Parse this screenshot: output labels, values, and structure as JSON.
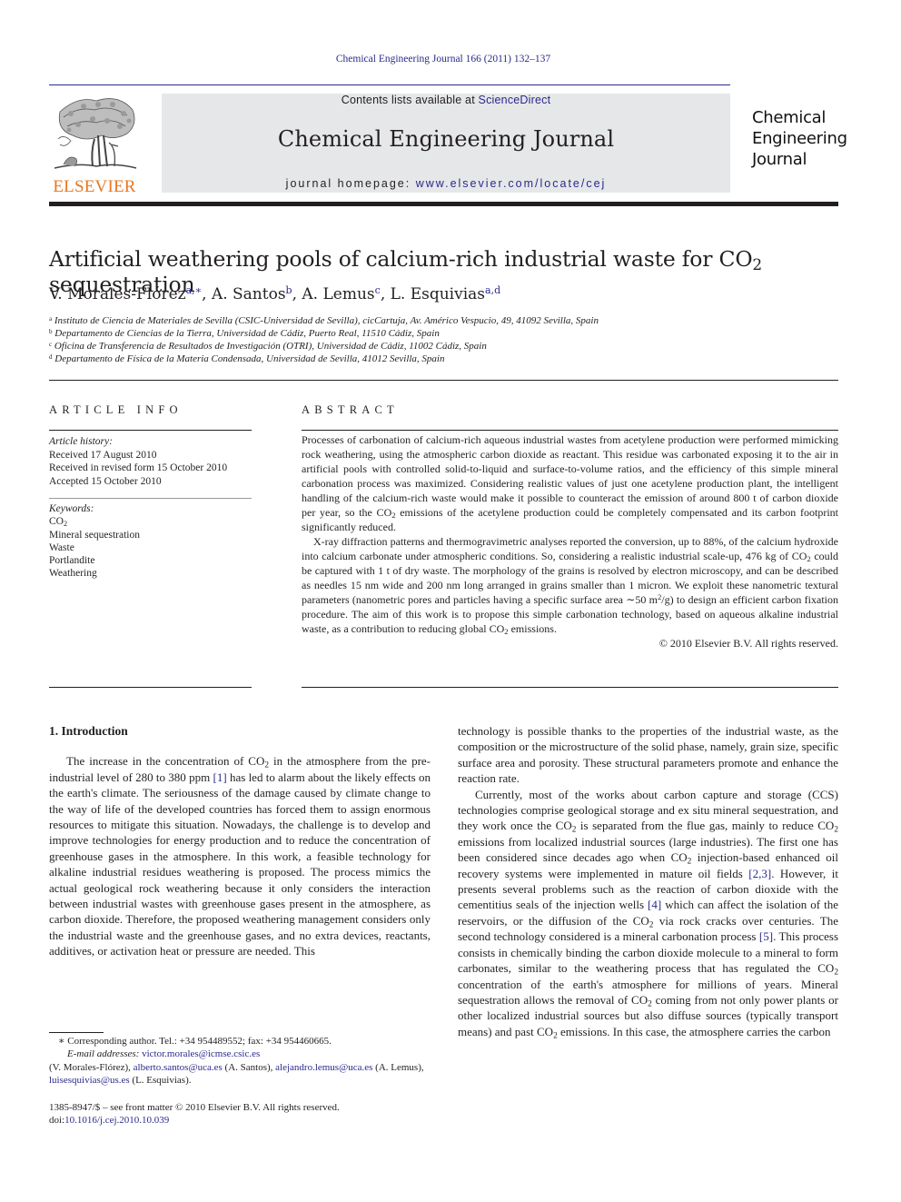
{
  "header": {
    "citation": "Chemical Engineering Journal 166 (2011) 132–137",
    "contents_prefix": "Contents lists available at ",
    "contents_link": "ScienceDirect",
    "journal_name": "Chemical Engineering Journal",
    "homepage_prefix": "journal homepage: ",
    "homepage_link": "www.elsevier.com/locate/cej",
    "publisher_logo_text": "ELSEVIER",
    "cover_title_lines": [
      "Chemical",
      "Engineering",
      "Journal"
    ],
    "colors": {
      "link": "#2a2a8c",
      "elsevier_orange": "#e87722",
      "banner_bg": "#e6e7e8"
    }
  },
  "article": {
    "title_main": "Artificial weathering pools of calcium-rich industrial waste for CO",
    "title_sub": "2",
    "title_end": " sequestration",
    "authors": [
      {
        "name": "V. Morales-Flórez",
        "affil": "a,∗"
      },
      {
        "name": "A. Santos",
        "affil": "b"
      },
      {
        "name": "A. Lemus",
        "affil": "c"
      },
      {
        "name": "L. Esquivias",
        "affil": "a,d"
      }
    ],
    "affiliations": [
      {
        "mark": "a",
        "text": "Instituto de Ciencia de Materiales de Sevilla (CSIC-Universidad de Sevilla), cicCartuja, Av. Américo Vespucio, 49, 41092 Sevilla, Spain"
      },
      {
        "mark": "b",
        "text": "Departamento de Ciencias de la Tierra, Universidad de Cádiz, Puerto Real, 11510 Cádiz, Spain"
      },
      {
        "mark": "c",
        "text": "Oficina de Transferencia de Resultados de Investigación (OTRI), Universidad de Cádiz, 11002 Cádiz, Spain"
      },
      {
        "mark": "d",
        "text": "Departamento de Física de la Materia Condensada, Universidad de Sevilla, 41012 Sevilla, Spain"
      }
    ]
  },
  "article_info": {
    "heading": "ARTICLE INFO",
    "history_label": "Article history:",
    "history": [
      "Received 17 August 2010",
      "Received in revised form 15 October 2010",
      "Accepted 15 October 2010"
    ],
    "keywords_label": "Keywords:",
    "keyword_co2_main": "CO",
    "keyword_co2_sub": "2",
    "keywords": [
      "Mineral sequestration",
      "Waste",
      "Portlandite",
      "Weathering"
    ]
  },
  "abstract": {
    "heading": "ABSTRACT",
    "p1a": "Processes of carbonation of calcium-rich aqueous industrial wastes from acetylene production were performed mimicking rock weathering, using the atmospheric carbon dioxide as reactant. This residue was carbonated exposing it to the air in artificial pools with controlled solid-to-liquid and surface-to-volume ratios, and the efficiency of this simple mineral carbonation process was maximized. Considering realistic values of just one acetylene production plant, the intelligent handling of the calcium-rich waste would make it possible to counteract the emission of around 800 t of carbon dioxide per year, so the CO",
    "p1b": " emissions of the acetylene production could be completely compensated and its carbon footprint significantly reduced.",
    "p2a": "X-ray diffraction patterns and thermogravimetric analyses reported the conversion, up to 88%, of the calcium hydroxide into calcium carbonate under atmospheric conditions. So, considering a realistic industrial scale-up, 476 kg of CO",
    "p2b": " could be captured with 1 t of dry waste. The morphology of the grains is resolved by electron microscopy, and can be described as needles 15 nm wide and 200 nm long arranged in grains smaller than 1 micron. We exploit these nanometric textural parameters (nanometric pores and particles having a specific surface area ∼50 m",
    "p2c": "/g) to design an efficient carbon fixation procedure. The aim of this work is to propose this simple carbonation technology, based on aqueous alkaline industrial waste, as a contribution to reducing global CO",
    "p2d": " emissions.",
    "sub2": "2",
    "sup2": "2",
    "copyright": "© 2010 Elsevier B.V. All rights reserved."
  },
  "introduction": {
    "heading": "1.  Introduction",
    "left_p1a": "The increase in the concentration of CO",
    "left_p1b": " in the atmosphere from the pre-industrial level of 280 to 380 ppm ",
    "cite1": "[1]",
    "left_p1c": " has led to alarm about the likely effects on the earth's climate. The seriousness of the damage caused by climate change to the way of life of the developed countries has forced them to assign enormous resources to mitigate this situation. Nowadays, the challenge is to develop and improve technologies for energy production and to reduce the concentration of greenhouse gases in the atmosphere. In this work, a feasible technology for alkaline industrial residues weathering is proposed. The process mimics the actual geological rock weathering because it only considers the interaction between industrial wastes with greenhouse gases present in the atmosphere, as carbon dioxide. Therefore, the proposed weathering management considers only the industrial waste and the greenhouse gases, and no extra devices, reactants, additives, or activation heat or pressure are needed. This",
    "right_p1": "technology is possible thanks to the properties of the industrial waste, as the composition or the microstructure of the solid phase, namely, grain size, specific surface area and porosity. These structural parameters promote and enhance the reaction rate.",
    "right_p2a": "Currently, most of the works about carbon capture and storage (CCS) technologies comprise geological storage and ex situ mineral sequestration, and they work once the CO",
    "right_p2b": " is separated from the flue gas, mainly to reduce CO",
    "right_p2c": " emissions from localized industrial sources (large industries). The first one has been considered since decades ago when CO",
    "right_p2d": " injection-based enhanced oil recovery systems were implemented in mature oil fields ",
    "cite23": "[2,3]",
    "right_p2e": ". However, it presents several problems such as the reaction of carbon dioxide with the cementitius seals of the injection wells ",
    "cite4": "[4]",
    "right_p2f": " which can affect the isolation of the reservoirs, or the diffusion of the CO",
    "right_p2g": " via rock cracks over centuries. The second technology considered is a mineral carbonation process ",
    "cite5": "[5]",
    "right_p2h": ". This process consists in chemically binding the carbon dioxide molecule to a mineral to form carbonates, similar to the weathering process that has regulated the CO",
    "right_p2i": " concentration of the earth's atmosphere for millions of years. Mineral sequestration allows the removal of CO",
    "right_p2j": " coming from not only power plants or other localized industrial sources but also diffuse sources (typically transport means) and past CO",
    "right_p2k": " emissions. In this case, the atmosphere carries the carbon",
    "sub2": "2"
  },
  "footnotes": {
    "corresponding": "∗ Corresponding author. Tel.: +34 954489552; fax: +34 954460665.",
    "email_label": "E-mail addresses: ",
    "emails": [
      {
        "address": "victor.morales@icmse.csic.es",
        "owner": "(V. Morales-Flórez), "
      },
      {
        "address": "alberto.santos@uca.es",
        "owner": " (A. Santos), "
      },
      {
        "address": "alejandro.lemus@uca.es",
        "owner": " (A. Lemus), "
      },
      {
        "address": "luisesquivias@us.es",
        "owner": " (L. Esquivias)."
      }
    ],
    "issn": "1385-8947/$ – see front matter © 2010 Elsevier B.V. All rights reserved.",
    "doi_label": "doi:",
    "doi": "10.1016/j.cej.2010.10.039"
  }
}
